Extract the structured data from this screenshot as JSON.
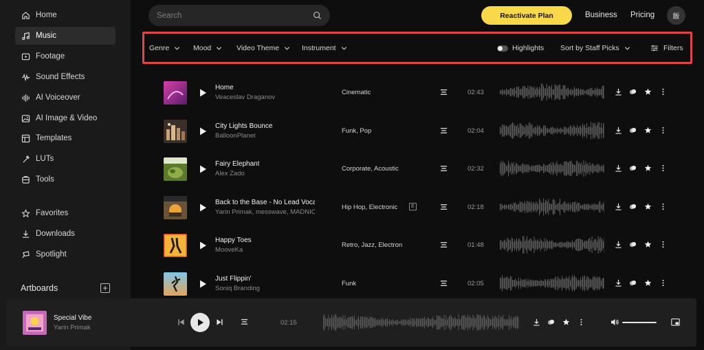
{
  "sidebar": {
    "items": [
      {
        "label": "Home",
        "icon": "home-icon"
      },
      {
        "label": "Music",
        "icon": "music-note-icon",
        "active": true
      },
      {
        "label": "Footage",
        "icon": "video-icon"
      },
      {
        "label": "Sound Effects",
        "icon": "waveform-icon"
      },
      {
        "label": "AI Voiceover",
        "icon": "voice-wave-icon"
      },
      {
        "label": "AI Image & Video",
        "icon": "image-icon"
      },
      {
        "label": "Templates",
        "icon": "template-icon"
      },
      {
        "label": "LUTs",
        "icon": "lut-icon"
      },
      {
        "label": "Tools",
        "icon": "tools-icon"
      }
    ],
    "secondary": [
      {
        "label": "Favorites",
        "icon": "star-outline-icon"
      },
      {
        "label": "Downloads",
        "icon": "download-icon"
      },
      {
        "label": "Spotlight",
        "icon": "spotlight-icon"
      }
    ],
    "artboards_label": "Artboards"
  },
  "header": {
    "search_placeholder": "Search",
    "reactivate_label": "Reactivate Plan",
    "business_label": "Business",
    "pricing_label": "Pricing",
    "avatar_text": "飯"
  },
  "filters": {
    "genre": "Genre",
    "mood": "Mood",
    "video_theme": "Video Theme",
    "instrument": "Instrument",
    "highlights": "Highlights",
    "sort": "Sort by Staff Picks",
    "filters": "Filters"
  },
  "tracks": [
    {
      "title": "Home",
      "artist": "Veaceslav Draganov",
      "genre": "Cinematic",
      "duration": "02:43",
      "explicit": false
    },
    {
      "title": "City Lights Bounce",
      "artist": "BalloonPlanet",
      "genre": "Funk, Pop",
      "duration": "02:04",
      "explicit": false
    },
    {
      "title": "Fairy Elephant",
      "artist": "Alex Zado",
      "genre": "Corporate, Acoustic",
      "duration": "02:32",
      "explicit": false
    },
    {
      "title": "Back to the Base - No Lead Vocals",
      "artist": "Yarin Primak, messwave, MADNIC",
      "genre": "Hip Hop, Electronic",
      "duration": "02:18",
      "explicit": true,
      "explicit_label": "E"
    },
    {
      "title": "Happy Toes",
      "artist": "MooveKa",
      "genre": "Retro, Jazz, Electronic",
      "duration": "01:48",
      "explicit": false
    },
    {
      "title": "Just Flippin'",
      "artist": "Soniq Branding",
      "genre": "Funk",
      "duration": "02:05",
      "explicit": false
    }
  ],
  "player": {
    "title": "Special Vibe",
    "artist": "Yarin Primak",
    "time": "02:15",
    "volume": 1.0
  },
  "colors": {
    "accent": "#f9d84a",
    "highlight_border": "#e04646",
    "background": "#0e0e0e",
    "sidebar": "#1a1a1a"
  }
}
